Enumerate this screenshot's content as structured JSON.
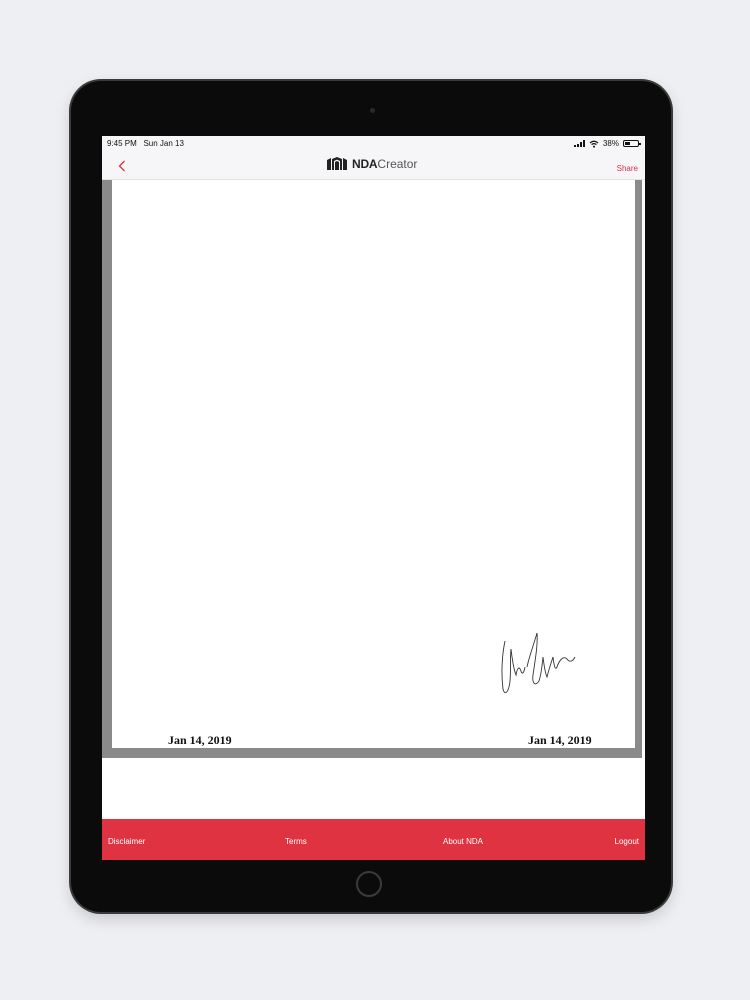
{
  "status_bar": {
    "time": "9:45 PM",
    "date": "Sun Jan 13",
    "battery": "38%"
  },
  "nav": {
    "back_icon": "chevron-left-icon",
    "logo_bold": "NDA",
    "logo_light": "Creator",
    "share_label": "Share"
  },
  "document": {
    "date_left": "Jan 14, 2019",
    "date_right": "Jan 14, 2019"
  },
  "tab_bar": {
    "disclaimer": "Disclaimer",
    "terms": "Terms",
    "about": "About NDA",
    "logout": "Logout"
  },
  "colors": {
    "accent": "#df3342",
    "device": "#0b0b0b",
    "background": "#eeeff3"
  }
}
